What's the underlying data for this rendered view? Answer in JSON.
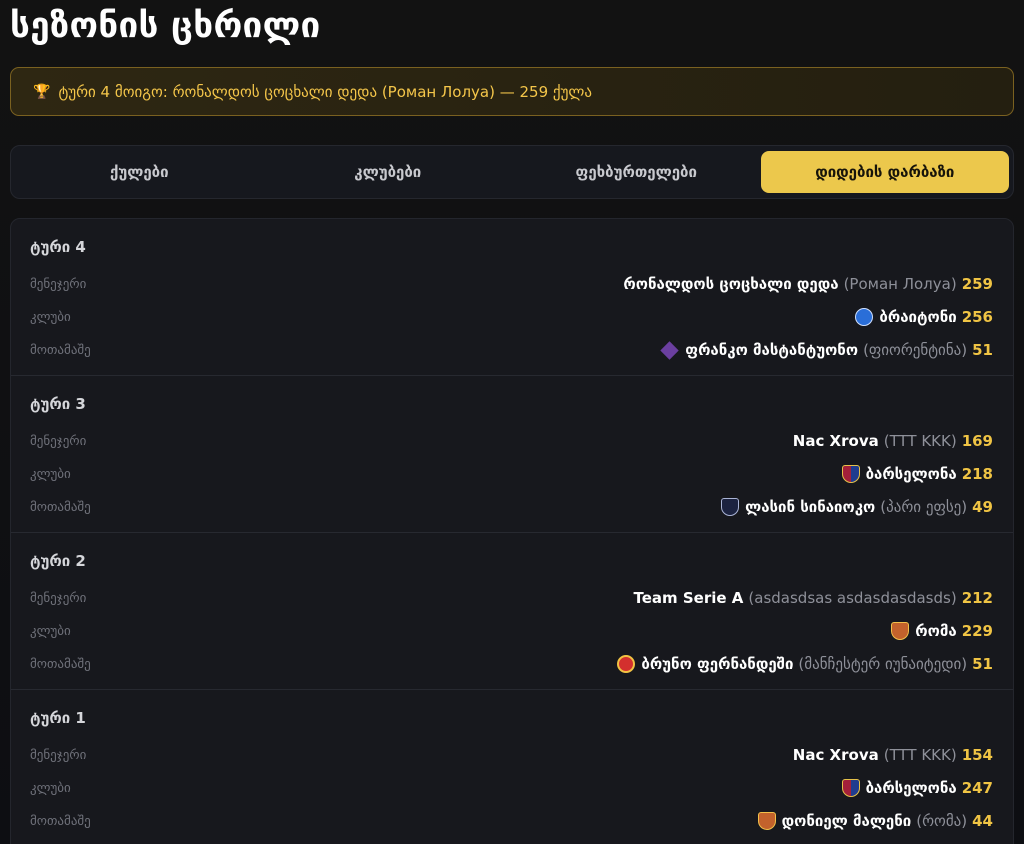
{
  "page_title": "სეზონის ცხრილი",
  "banner": {
    "icon": "trophy-icon",
    "text": "ტური 4 მოიგო: რონალდოს ცოცხალი დედა (Роман Лолуа) — 259 ქულა"
  },
  "tabs": [
    {
      "label": "ქულები",
      "active": false
    },
    {
      "label": "კლუბები",
      "active": false
    },
    {
      "label": "ფეხბურთელები",
      "active": false
    },
    {
      "label": "დიდების დარბაზი",
      "active": true
    }
  ],
  "labels": {
    "manager": "მენეჯერი",
    "club": "კლუბი",
    "player": "მოთამაშე"
  },
  "rounds": [
    {
      "title": "ტური 4",
      "manager": {
        "name": "რონალდოს ცოცხალი დედა",
        "owner": "(Роман Лолуа)",
        "points": "259"
      },
      "club": {
        "name": "ბრაიტონი",
        "icon": "brighton-crest-icon",
        "points": "256"
      },
      "player": {
        "name": "ფრანკო მასტანტუონო",
        "club": "(ფიორენტინა)",
        "icon": "fiorentina-crest-icon",
        "points": "51"
      }
    },
    {
      "title": "ტური 3",
      "manager": {
        "name": "Nac Xrova",
        "owner": "(TTT KKK)",
        "points": "169"
      },
      "club": {
        "name": "ბარსელონა",
        "icon": "barcelona-crest-icon",
        "points": "218"
      },
      "player": {
        "name": "ლასინ სინაიოკო",
        "club": "(პარი ეფსე)",
        "icon": "paris-fc-crest-icon",
        "points": "49"
      }
    },
    {
      "title": "ტური 2",
      "manager": {
        "name": "Team Serie A",
        "owner": "(asdasdsas asdasdasdasds)",
        "points": "212"
      },
      "club": {
        "name": "რომა",
        "icon": "roma-crest-icon",
        "points": "229"
      },
      "player": {
        "name": "ბრუნო ფერნანდეში",
        "club": "(მანჩესტერ იუნაიტედი)",
        "icon": "man-utd-crest-icon",
        "points": "51"
      }
    },
    {
      "title": "ტური 1",
      "manager": {
        "name": "Nac Xrova",
        "owner": "(TTT KKK)",
        "points": "154"
      },
      "club": {
        "name": "ბარსელონა",
        "icon": "barcelona-crest-icon",
        "points": "247"
      },
      "player": {
        "name": "დონიელ მალენი",
        "club": "(რომა)",
        "icon": "roma-crest-icon",
        "points": "44"
      }
    }
  ],
  "colors": {
    "accent": "#ecc84c",
    "points": "#f0c444",
    "background": "#0d0e12",
    "panel": "#17181d"
  }
}
